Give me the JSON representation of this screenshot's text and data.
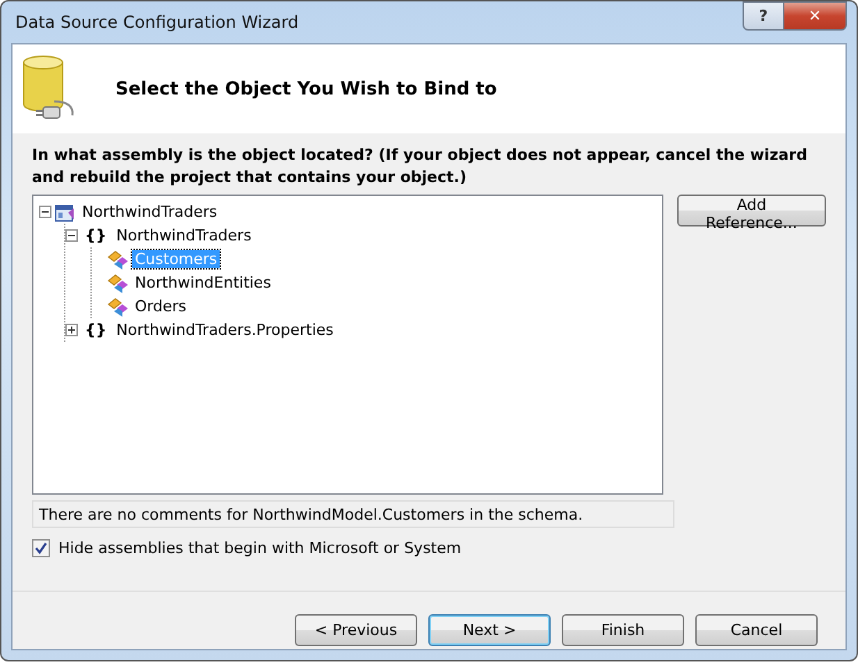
{
  "window": {
    "title": "Data Source Configuration Wizard",
    "help_button": "?",
    "close_button": "✕"
  },
  "header": {
    "title": "Select the Object You Wish to Bind to"
  },
  "prompt": "In what assembly is the object located? (If your object does not appear, cancel the wizard and rebuild the project that contains your object.)",
  "tree": [
    {
      "label": "NorthwindTraders",
      "kind": "assembly",
      "expanded": true,
      "selected": false,
      "children": [
        {
          "label": "NorthwindTraders",
          "kind": "namespace",
          "glyph": "{}",
          "expanded": true,
          "selected": false,
          "children": [
            {
              "label": "Customers",
              "kind": "class",
              "selected": true
            },
            {
              "label": "NorthwindEntities",
              "kind": "class",
              "selected": false
            },
            {
              "label": "Orders",
              "kind": "class",
              "selected": false
            }
          ]
        },
        {
          "label": "NorthwindTraders.Properties",
          "kind": "namespace",
          "glyph": "{}",
          "expanded": false,
          "selected": false
        }
      ]
    }
  ],
  "add_reference_button": "Add Reference...",
  "comment": "There are no comments for NorthwindModel.Customers in the schema.",
  "hide_assemblies": {
    "label": "Hide assemblies that begin with Microsoft or System",
    "checked": true
  },
  "buttons": [
    {
      "label": "< Previous",
      "default": false
    },
    {
      "label": "Next >",
      "default": true
    },
    {
      "label": "Finish",
      "default": false
    },
    {
      "label": "Cancel",
      "default": false
    }
  ]
}
